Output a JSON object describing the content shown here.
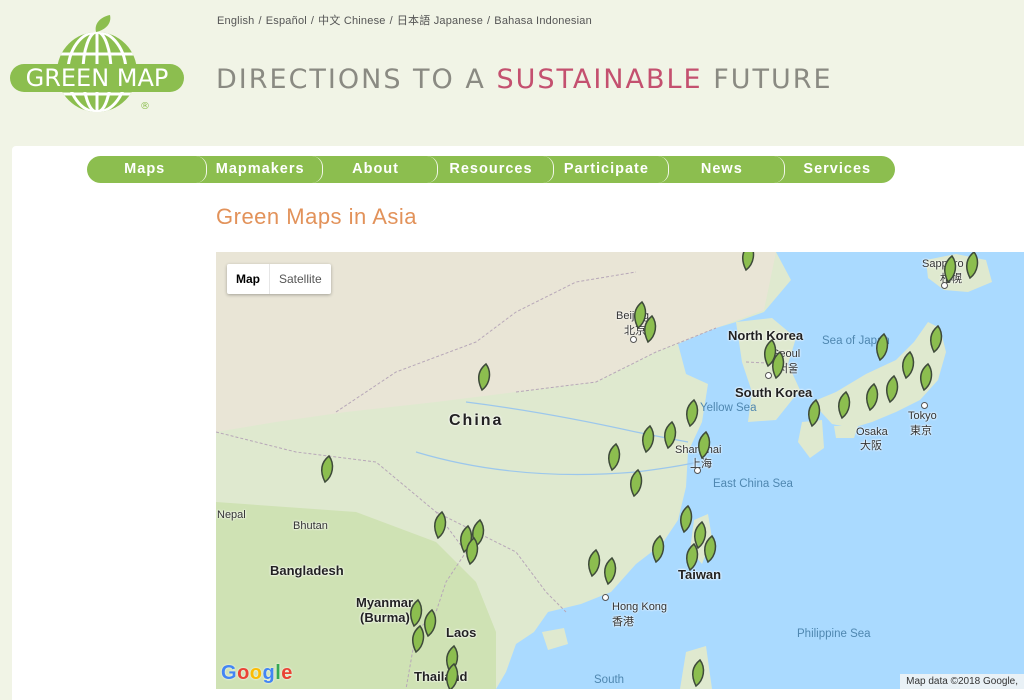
{
  "languages": [
    "English",
    "Español",
    "中文 Chinese",
    "日本語 Japanese",
    "Bahasa Indonesian"
  ],
  "language_separator": "/",
  "logo": {
    "text": "GREEN MAP",
    "registered": "®"
  },
  "tagline": {
    "part1": "DIRECTIONS TO A ",
    "accent": "SUSTAINABLE",
    "part2": " FUTURE"
  },
  "nav": [
    "Maps",
    "Mapmakers",
    "About",
    "Resources",
    "Participate",
    "News",
    "Services"
  ],
  "page_title": "Green Maps in Asia",
  "map": {
    "type_buttons": {
      "map": "Map",
      "satellite": "Satellite"
    },
    "labels": {
      "north_korea": "North Korea",
      "seoul_en": "Seoul",
      "seoul_ko": "서울",
      "south_korea": "South Korea",
      "sea_of_japan": "Sea of Japan",
      "china": "China",
      "yellow_sea": "Yellow Sea",
      "osaka_en": "Osaka",
      "osaka_ja": "大阪",
      "tokyo_en": "Tokyo",
      "tokyo_ja": "東京",
      "sapporo_en": "Sapporo",
      "sapporo_ja": "札幌",
      "beijing_en": "Beijing",
      "beijing_zh": "北京",
      "shanghai_en": "Shanghai",
      "shanghai_zh": "上海",
      "east_china_sea": "East China Sea",
      "nepal": "Nepal",
      "bhutan": "Bhutan",
      "bangladesh": "Bangladesh",
      "myanmar": "Myanmar",
      "burma": "(Burma)",
      "laos": "Laos",
      "thailand": "Thailand",
      "hong_kong_en": "Hong Kong",
      "hong_kong_zh": "香港",
      "taiwan": "Taiwan",
      "philippine_sea": "Philippine Sea",
      "south_china_sea": "South"
    },
    "google": [
      "G",
      "o",
      "o",
      "g",
      "l",
      "e"
    ],
    "google_colors": [
      "#4285f4",
      "#ea4335",
      "#fbbc05",
      "#4285f4",
      "#34a853",
      "#ea4335"
    ],
    "attribution": "Map data ©2018 Google,"
  },
  "colors": {
    "brand_green": "#8cbe4f",
    "title_orange": "#e2925a",
    "tagline_accent": "#c4506f",
    "marker_fill": "#8cbe4f",
    "marker_stroke": "#3e4a3a"
  }
}
